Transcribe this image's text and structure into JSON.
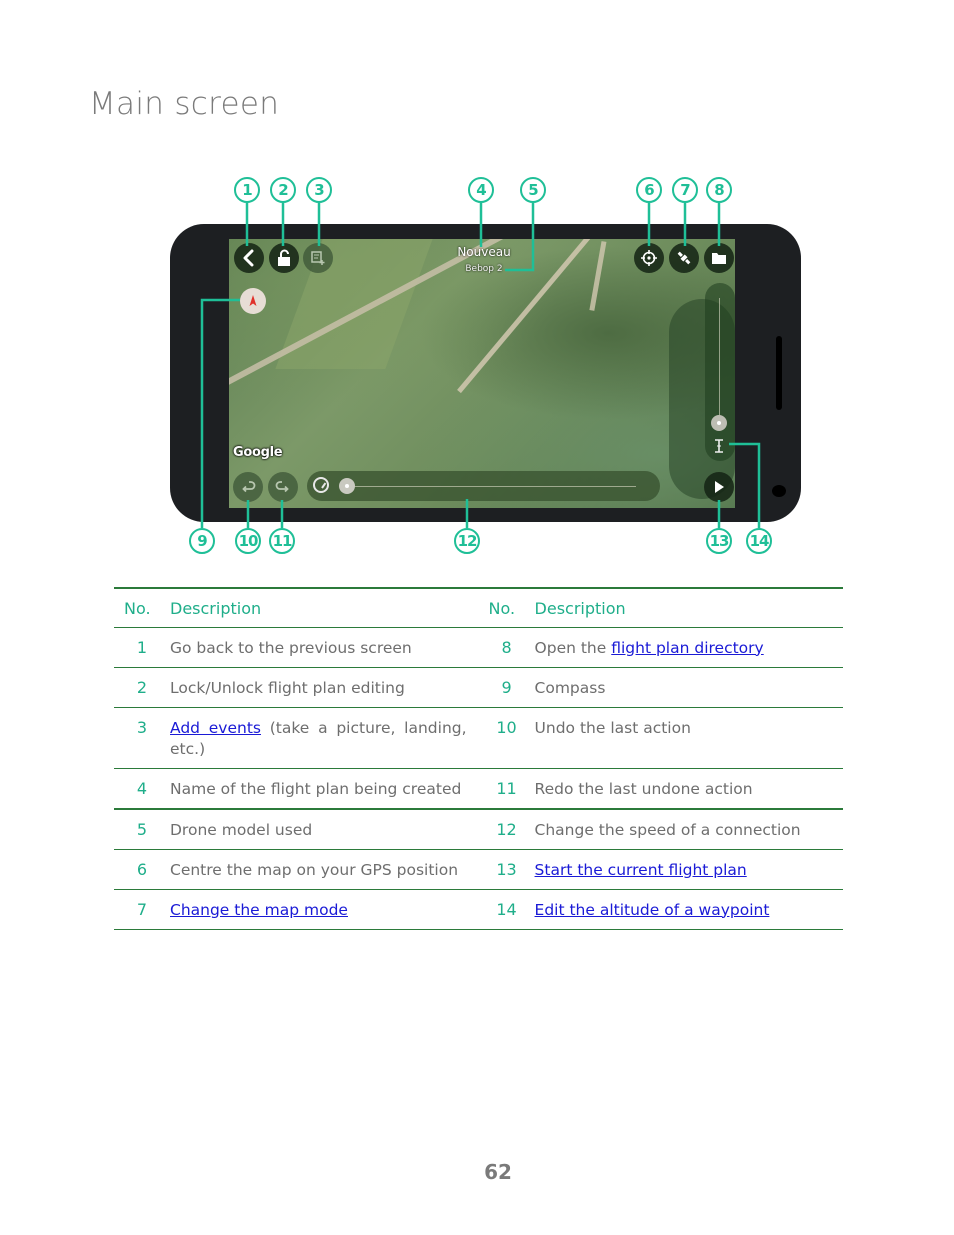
{
  "page": {
    "title": "Main screen",
    "page_number": "62"
  },
  "app_screen": {
    "flight_plan_name": "Nouveau",
    "drone_model": "Bebop 2",
    "map_attribution": "Google",
    "icons": {
      "back": "chevron-left-icon",
      "lock": "unlock-icon",
      "add_event": "add-event-icon",
      "gps_center": "crosshair-icon",
      "map_mode": "satellite-icon",
      "directory": "folder-icon",
      "compass": "compass-icon",
      "undo": "undo-icon",
      "redo": "redo-icon",
      "speed": "speedometer-icon",
      "play": "play-icon",
      "altitude": "altitude-icon"
    },
    "accent_color": "#1fbf97"
  },
  "callouts": [
    "1",
    "2",
    "3",
    "4",
    "5",
    "6",
    "7",
    "8",
    "9",
    "10",
    "11",
    "12",
    "13",
    "14"
  ],
  "table": {
    "headers": {
      "no": "No.",
      "description": "Description"
    },
    "rows": [
      {
        "left": {
          "no": "1",
          "text": "Go back to the previous screen"
        },
        "right": {
          "no": "8",
          "prefix": "Open the ",
          "link": "flight plan directory"
        }
      },
      {
        "left": {
          "no": "2",
          "text": "Lock/Unlock flight plan editing"
        },
        "right": {
          "no": "9",
          "text": "Compass"
        }
      },
      {
        "left": {
          "no": "3",
          "link": "Add events",
          "suffix": " (take a picture, landing, etc.)"
        },
        "right": {
          "no": "10",
          "text": "Undo the last action"
        }
      },
      {
        "left": {
          "no": "4",
          "text": "Name of the flight plan being created"
        },
        "right": {
          "no": "11",
          "text": "Redo the last undone action"
        }
      },
      {
        "left": {
          "no": "5",
          "text": "Drone model used"
        },
        "right": {
          "no": "12",
          "text": "Change the speed of a connection"
        }
      },
      {
        "left": {
          "no": "6",
          "text": "Centre the map on your GPS position"
        },
        "right": {
          "no": "13",
          "link": "Start the current flight plan "
        }
      },
      {
        "left": {
          "no": "7",
          "link": "Change the map mode"
        },
        "right": {
          "no": "14",
          "link": "Edit the altitude of a waypoint"
        }
      }
    ]
  }
}
